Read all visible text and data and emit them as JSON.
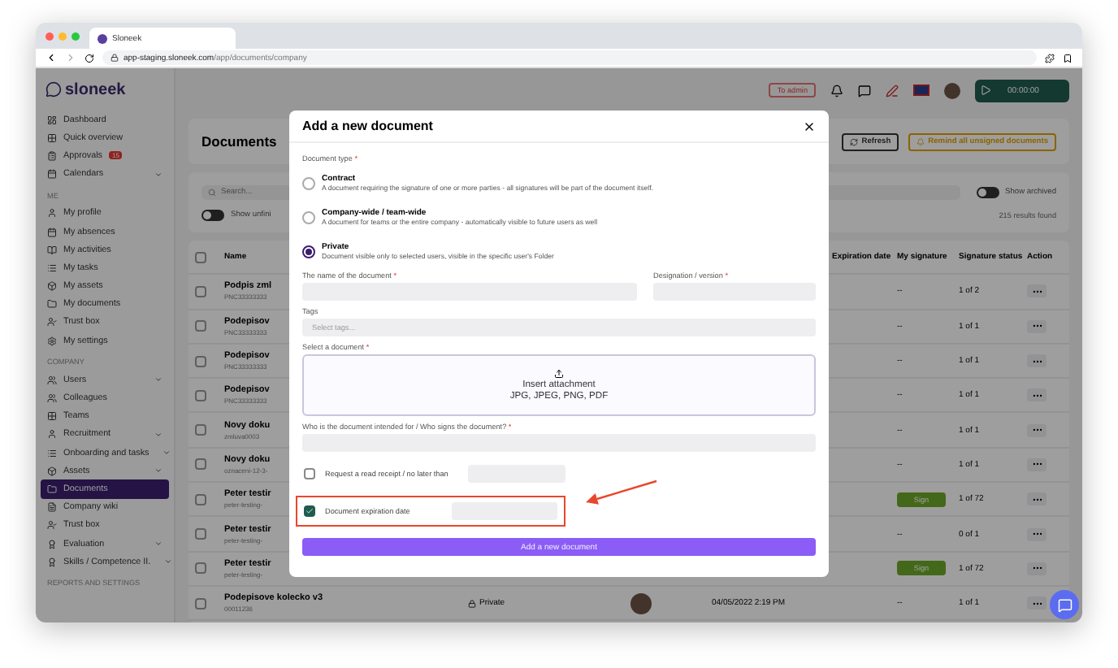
{
  "browser": {
    "tab_title": "Sloneek",
    "url_host": "app-staging.sloneek.com",
    "url_path": "/app/documents/company"
  },
  "topbar": {
    "logo": "sloneek",
    "admin_button": "To admin",
    "timer": "00:00:00"
  },
  "sidebar": {
    "sections": [
      {
        "items": [
          {
            "label": "Dashboard",
            "selected": false,
            "expandable": false
          },
          {
            "label": "Quick overview",
            "selected": false,
            "expandable": false
          },
          {
            "label": "Approvals",
            "selected": false,
            "expandable": false,
            "badge": "15"
          },
          {
            "label": "Calendars",
            "selected": false,
            "expandable": true
          }
        ]
      },
      {
        "heading": "ME",
        "items": [
          {
            "label": "My profile",
            "selected": false,
            "expandable": false
          },
          {
            "label": "My absences",
            "selected": false,
            "expandable": false
          },
          {
            "label": "My activities",
            "selected": false,
            "expandable": false
          },
          {
            "label": "My tasks",
            "selected": false,
            "expandable": false
          },
          {
            "label": "My assets",
            "selected": false,
            "expandable": false
          },
          {
            "label": "My documents",
            "selected": false,
            "expandable": false
          },
          {
            "label": "Trust box",
            "selected": false,
            "expandable": false
          },
          {
            "label": "My settings",
            "selected": false,
            "expandable": false
          }
        ]
      },
      {
        "heading": "COMPANY",
        "items": [
          {
            "label": "Users",
            "selected": false,
            "expandable": true
          },
          {
            "label": "Colleagues",
            "selected": false,
            "expandable": false
          },
          {
            "label": "Teams",
            "selected": false,
            "expandable": false
          },
          {
            "label": "Recruitment",
            "selected": false,
            "expandable": true
          },
          {
            "label": "Onboarding and tasks",
            "selected": false,
            "expandable": true
          },
          {
            "label": "Assets",
            "selected": false,
            "expandable": true
          },
          {
            "label": "Documents",
            "selected": true,
            "expandable": false
          },
          {
            "label": "Company wiki",
            "selected": false,
            "expandable": false
          },
          {
            "label": "Trust box",
            "selected": false,
            "expandable": false
          },
          {
            "label": "Evaluation",
            "selected": false,
            "expandable": true
          },
          {
            "label": "Skills / Competence II.",
            "selected": false,
            "expandable": true
          }
        ]
      },
      {
        "heading": "REPORTS AND SETTINGS"
      }
    ]
  },
  "page": {
    "title": "Documents",
    "refresh_button": "Refresh",
    "remind_button": "Remind all unsigned documents",
    "search": {
      "placeholder": "Search..."
    },
    "toggles": [
      {
        "label": "Show unfini",
        "on": false
      },
      {
        "label": "Show archived",
        "on": false
      }
    ],
    "results": "215 results found",
    "table": {
      "all_selected": false,
      "columns": [
        "Name",
        "Expiration date",
        "My signature",
        "Signature status",
        "Action"
      ],
      "rows": [
        {
          "selected": false,
          "name": "Podpis zml",
          "code": "PNC33333333",
          "signature": {
            "kind": "text",
            "label": "--"
          },
          "status": "1 of 2"
        },
        {
          "selected": false,
          "name": "Podepisov",
          "code": "PNC33333333",
          "signature": {
            "kind": "text",
            "label": "--"
          },
          "status": "1 of 1"
        },
        {
          "selected": false,
          "name": "Podepisov",
          "code": "PNC33333333",
          "signature": {
            "kind": "text",
            "label": "--"
          },
          "status": "1 of 1"
        },
        {
          "selected": false,
          "name": "Podepisov",
          "code": "PNC33333333",
          "signature": {
            "kind": "text",
            "label": "--"
          },
          "status": "1 of 1"
        },
        {
          "selected": false,
          "name": "Novy doku",
          "code": "zmluva0003",
          "signature": {
            "kind": "text",
            "label": "--"
          },
          "status": "1 of 1"
        },
        {
          "selected": false,
          "name": "Novy doku",
          "code": "oznaceni-12-3-",
          "signature": {
            "kind": "text",
            "label": "--"
          },
          "status": "1 of 1"
        },
        {
          "selected": false,
          "name": "Peter testir",
          "code": "peter-testing-",
          "signature": {
            "kind": "button",
            "label": "Sign"
          },
          "status": "1 of 72"
        },
        {
          "selected": false,
          "name": "Peter testir",
          "code": "peter-testing-",
          "signature": {
            "kind": "text",
            "label": "--"
          },
          "status": "0 of 1"
        },
        {
          "selected": false,
          "name": "Peter testir",
          "code": "peter-testing-",
          "signature": {
            "kind": "button",
            "label": "Sign"
          },
          "status": "1 of 72"
        },
        {
          "selected": false,
          "name": "Podepisove kolecko v3",
          "code": "00011236",
          "type": "Private",
          "date": "04/05/2022 2:19 PM",
          "signature": {
            "kind": "text",
            "label": "--"
          },
          "status": "1 of 1"
        }
      ]
    }
  },
  "modal": {
    "title": "Add a new document",
    "type_label": {
      "text": "Document type",
      "mark": "*"
    },
    "types": [
      {
        "title": "Contract",
        "description": "A document requiring the signature of one or more parties - all signatures will be part of the document itself.",
        "selected": false
      },
      {
        "title": "Company-wide / team-wide",
        "description": "A document for teams or the entire company - automatically visible to future users as well",
        "selected": false
      },
      {
        "title": "Private",
        "description": "Document visible only to selected users, visible in the specific user's Folder",
        "selected": true
      }
    ],
    "name_label": {
      "text": "The name of the document",
      "mark": "*"
    },
    "version_label": {
      "text": "Designation / version",
      "mark": "*"
    },
    "tags_label": {
      "text": "Tags"
    },
    "tags_placeholder": "Select tags...",
    "file_label": {
      "text": "Select a document",
      "mark": "*"
    },
    "upload_title": "Insert attachment",
    "upload_formats": "JPG, JPEG, PNG, PDF",
    "recipient_label": {
      "text": "Who is the document intended for / Who signs the document?",
      "mark": "*"
    },
    "options": [
      {
        "label": "Request a read receipt / no later than",
        "checked": false,
        "highlighted": false
      },
      {
        "label": "Document expiration date",
        "checked": true,
        "highlighted": true
      }
    ],
    "submit": "Add a new document"
  }
}
